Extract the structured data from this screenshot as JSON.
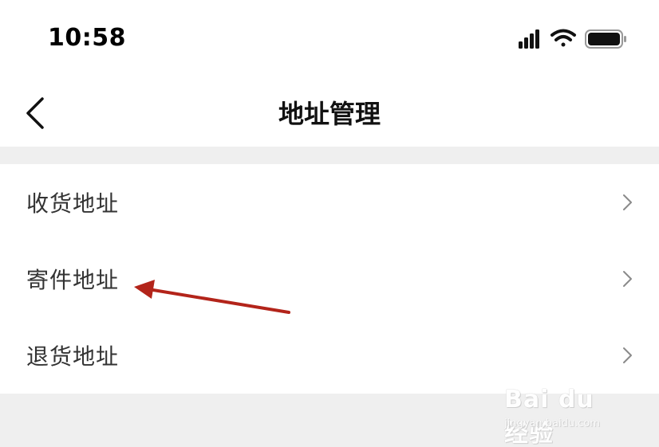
{
  "status_bar": {
    "time": "10:58"
  },
  "nav": {
    "title": "地址管理"
  },
  "list": {
    "items": [
      {
        "label": "收货地址"
      },
      {
        "label": "寄件地址"
      },
      {
        "label": "退货地址"
      }
    ]
  },
  "icons": {
    "back": "chevron-left-icon",
    "row": "chevron-right-icon",
    "signal": "signal-icon",
    "wifi": "wifi-icon",
    "battery": "battery-icon"
  },
  "annotation": {
    "arrow_color": "#b3241a",
    "points_to": "寄件地址"
  },
  "watermark": {
    "main": "Bai du 经验",
    "sub": "jingyan.baidu.com"
  }
}
